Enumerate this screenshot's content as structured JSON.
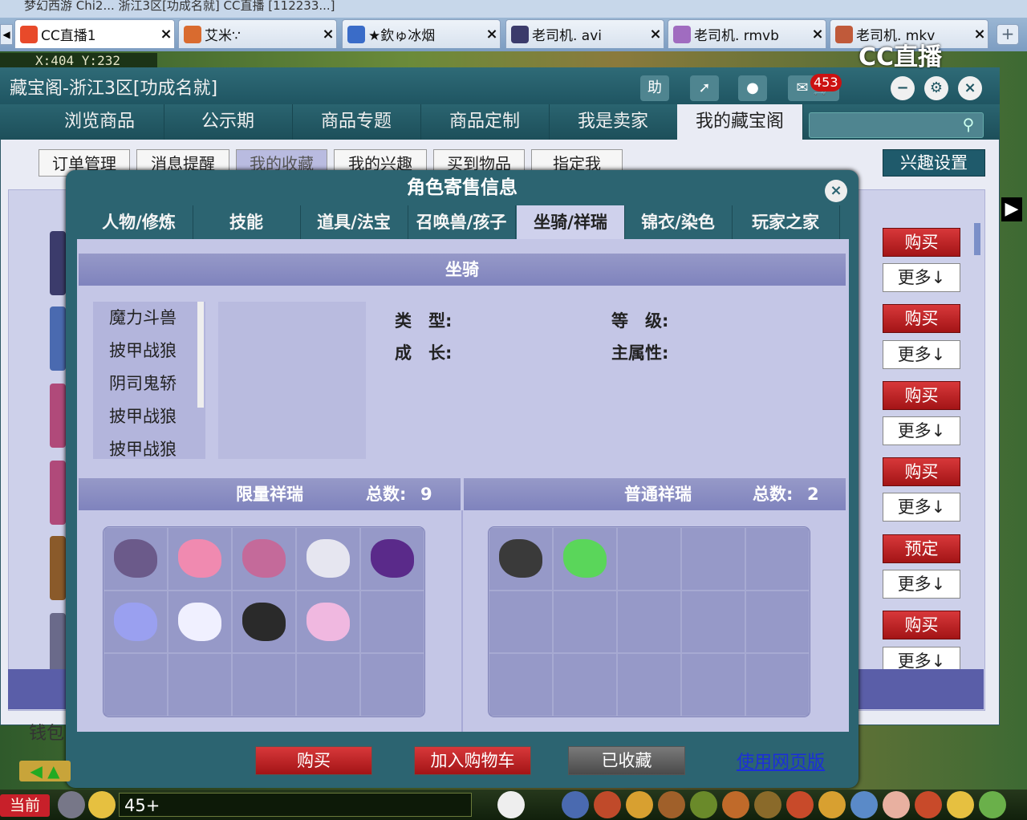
{
  "browser": {
    "top_text": "梦幻西游   Chi2...   浙江3区[功成名就]   CC直播 [112233...]",
    "tabs": [
      {
        "title": "CC直播1",
        "active": true,
        "color": "#e84a2a"
      },
      {
        "title": "艾米∵",
        "active": false,
        "color": "#d96b2f"
      },
      {
        "title": "★欽ゅ冰烟",
        "active": false,
        "color": "#3a6cc8"
      },
      {
        "title": "老司机. avi",
        "active": false,
        "color": "#3b3b6b"
      },
      {
        "title": "老司机. rmvb",
        "active": false,
        "color": "#a06cc0"
      },
      {
        "title": "老司机. mkv",
        "active": false,
        "color": "#c05a3a"
      }
    ],
    "new_tab": "+"
  },
  "game": {
    "coords": "X:404 Y:232",
    "watermark": "CC直播",
    "bottom_bar": {
      "current_label": "当前",
      "chat_value": "45+"
    }
  },
  "window": {
    "title": "藏宝阁-浙江3区[功成名就]",
    "help_label": "助",
    "message_count": "453",
    "nav_tabs": [
      "浏览商品",
      "公示期",
      "商品专题",
      "商品定制",
      "我是卖家",
      "我的藏宝阁"
    ],
    "active_nav": 5,
    "search_placeholder": "",
    "sub_tabs": [
      "订单管理",
      "消息提醒",
      "我的收藏",
      "我的兴趣",
      "买到物品",
      "指定我"
    ],
    "active_sub": 2,
    "interest_settings": "兴趣设置",
    "row_buttons": [
      {
        "primary": "购买",
        "secondary": "更多↓"
      },
      {
        "primary": "购买",
        "secondary": "更多↓"
      },
      {
        "primary": "购买",
        "secondary": "更多↓"
      },
      {
        "primary": "购买",
        "secondary": "更多↓"
      },
      {
        "primary": "预定",
        "secondary": "更多↓"
      },
      {
        "primary": "购买",
        "secondary": "更多↓"
      }
    ],
    "wallet_label": "钱包"
  },
  "modal": {
    "title": "角色寄售信息",
    "tabs": [
      "人物/修炼",
      "技能",
      "道具/法宝",
      "召唤兽/孩子",
      "坐骑/祥瑞",
      "锦衣/染色",
      "玩家之家"
    ],
    "active_tab": 4,
    "mount_section": "坐骑",
    "mounts": [
      "魔力斗兽",
      "披甲战狼",
      "阴司鬼轿",
      "披甲战狼",
      "披甲战狼"
    ],
    "attrs": {
      "type_label": "类　型:",
      "grade_label": "等　级:",
      "growth_label": "成　长:",
      "main_attr_label": "主属性:"
    },
    "limited": {
      "label": "限量祥瑞",
      "total_label": "总数:",
      "total": "9",
      "pet_colors": [
        "#6b5a8a",
        "#f08ab0",
        "#c46a9a",
        "#e6e6f0",
        "#5a2a8a",
        "#9aa0f0",
        "#f0f0ff",
        "#2a2a2a",
        "#f0b8e0"
      ]
    },
    "normal": {
      "label": "普通祥瑞",
      "total_label": "总数:",
      "total": "2",
      "pet_colors": [
        "#3a3a3a",
        "#5ad65a"
      ]
    },
    "buttons": {
      "buy": "购买",
      "add_cart": "加入购物车",
      "collected": "已收藏",
      "web_version": "使用网页版"
    }
  }
}
